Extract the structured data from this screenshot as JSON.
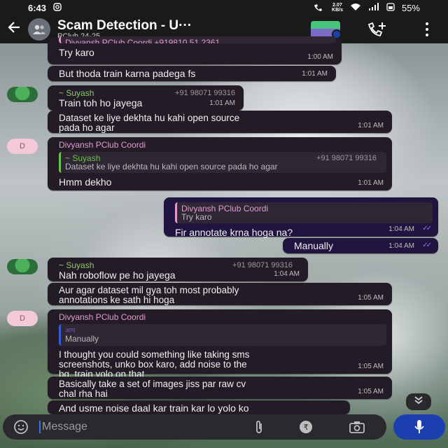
{
  "status_bar": {
    "time": "6:43",
    "net_speed_value": "2.07",
    "net_speed_unit": "KB/s",
    "battery": "55%"
  },
  "header": {
    "title": "Scam Detection - U···",
    "subtitle": "PClub 24-25"
  },
  "messages": [
    {
      "text": "Try karo",
      "time": "1:00 AM",
      "quoted_name": "Divyansh PClub Coordi +919810 51 2361"
    },
    {
      "text": "But thoda train karna padega fs",
      "time": "1:01 AM"
    },
    {
      "sender": "~ Suyash",
      "phone": "+91 98071 99316",
      "text": "Train toh ho jayega",
      "time": "1:01 AM"
    },
    {
      "text": "Dataset ke liye dekhta hu kahi open source\npada ho agar",
      "time": "1:01 AM"
    },
    {
      "avatar_letter": "D",
      "sender": "Divyansh PClub Coordi",
      "quote_name": "~ Suyash",
      "quote_phone": "+91 98071 99316",
      "quote_text": "Dataset ke liye dekhta hu kahi open source pada ho agar",
      "text": "Hmm dekho",
      "time": "1:01 AM"
    },
    {
      "out": true,
      "quote_name": "Divyansh PClub Coordi",
      "quote_text": "Try karo",
      "text": "Fir annotate krna hoga na?",
      "time": "1:04 AM"
    },
    {
      "out": true,
      "text": "Manually",
      "time": "1:04 AM"
    },
    {
      "sender": "~ Suyash",
      "phone": "+91 98071 99316",
      "text": "Nah roboflow pe ho jayega",
      "time": "1:04 AM"
    },
    {
      "text": "Aur agar dataset mil gya toh most probably\nannotations ke sath hi hoga",
      "time": "1:05 AM"
    },
    {
      "avatar_letter": "D",
      "sender": "Divyansh PClub Coordi",
      "quote_name": "आप",
      "quote_text": "Manually",
      "text": "I thought you could something like taking sms\nscreenshots, unko box karo, add noise to the\nbg, train yolo on that",
      "time": "1:05 AM"
    },
    {
      "text": "Basically take a set of images jiss par raw cv\nchal rha hai",
      "time": "1:05 AM"
    },
    {
      "text": "And usme noise daal kar train kar lo yolo ko"
    }
  ],
  "composer": {
    "placeholder": "Message"
  },
  "colors": {
    "incoming_bubble": "#231c26",
    "outgoing_bubble": "#1f1540",
    "suyash_name": "#8fc96a",
    "divyansh_name": "#e29bd0",
    "mic_button": "#1c3fb0"
  }
}
